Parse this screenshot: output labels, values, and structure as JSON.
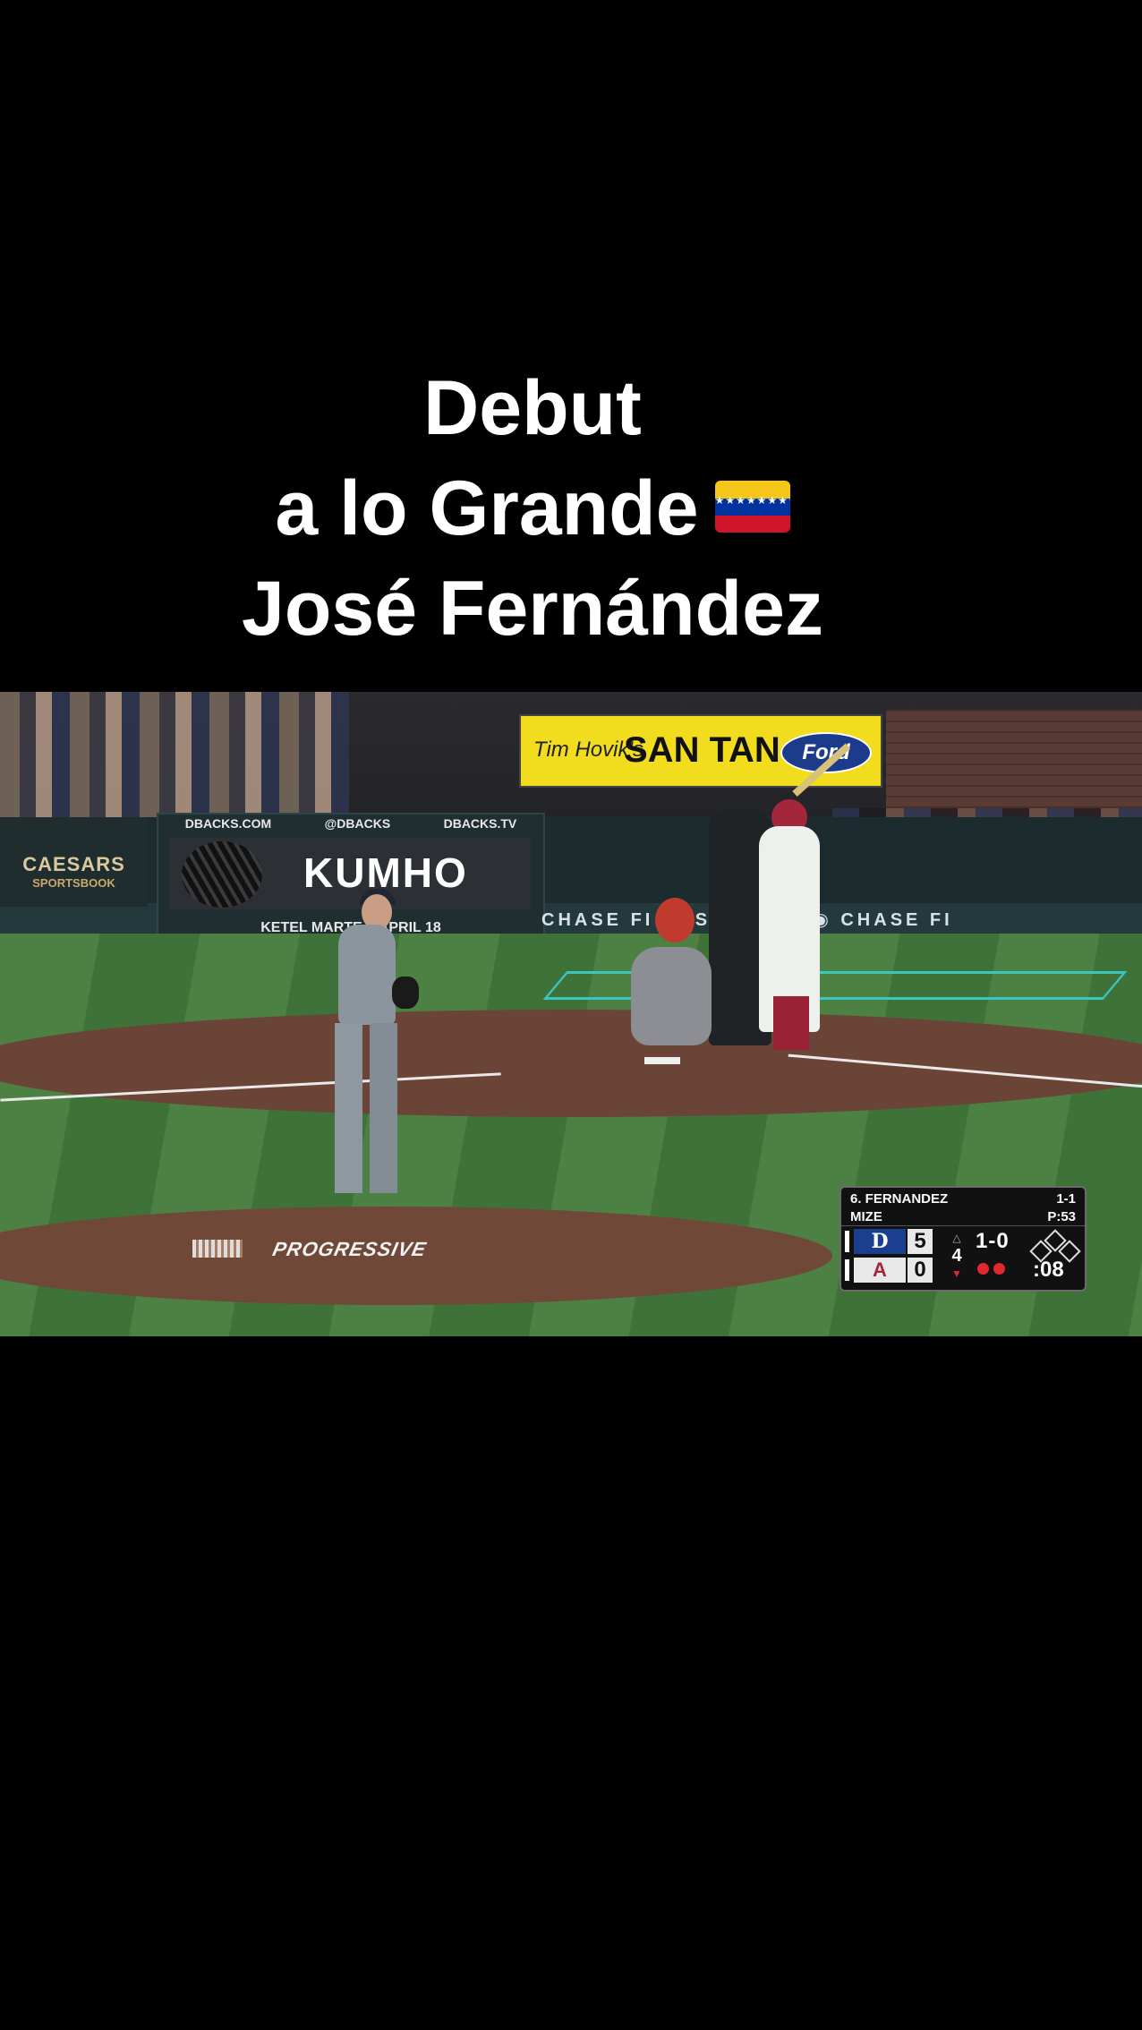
{
  "caption": {
    "line1": "Debut",
    "line2": "a lo Grande",
    "line3": "José Fernández",
    "flag_icon": "venezuela-flag-icon",
    "flag_colors": [
      "#f5c518",
      "#0033a0",
      "#cf142b"
    ]
  },
  "video": {
    "signs": {
      "dbacks_com": "DBACKS.COM",
      "dbacks_handle": "@DBACKS",
      "dbacks_tv": "DBACKS.TV",
      "caesars": "CAESARS",
      "caesars_sub": "SPORTSBOOK",
      "kumho": "KUMHO",
      "kumho_bottom": "KETEL MARTE T     APRIL 18",
      "santan_script": "Tim Hovik's",
      "santan": "SAN TAN",
      "ford": "Ford",
      "chase": "CHASE FI      HASE FIELD  ◉  CHASE FI",
      "progressive": "PROGRESSIVE"
    },
    "scorebug": {
      "batter": "6. FERNANDEZ",
      "batter_line": "1-1",
      "pitcher": "MIZE",
      "pitch_count": "P:53",
      "away_logo": "D",
      "away_score": "5",
      "home_logo": "A",
      "home_score": "0",
      "inning": "4",
      "count": "1-0",
      "clock": ":08",
      "outs": 2,
      "away_color": "#1b3f8f",
      "home_color": "#a3263a"
    }
  }
}
